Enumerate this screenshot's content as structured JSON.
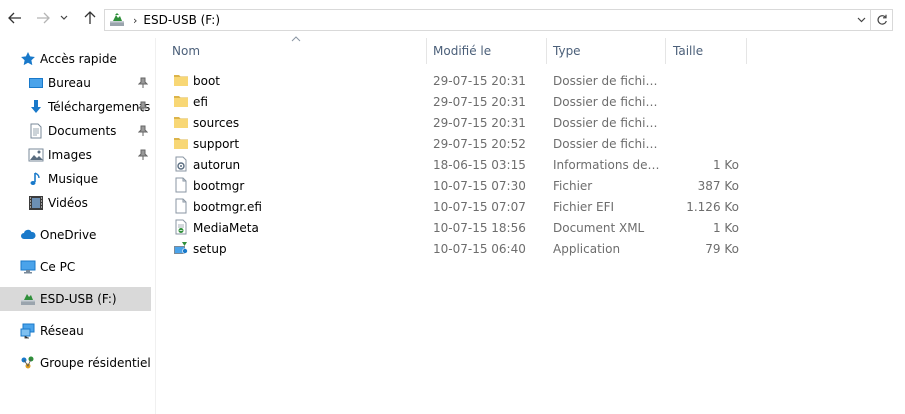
{
  "address": {
    "location_label": "ESD-USB (F:)"
  },
  "sidebar": {
    "items": [
      {
        "label": "Accès rapide",
        "icon": "star-icon"
      },
      {
        "label": "Bureau",
        "icon": "desktop-icon",
        "pinned": true
      },
      {
        "label": "Téléchargements",
        "icon": "download-icon",
        "pinned": true
      },
      {
        "label": "Documents",
        "icon": "documents-icon",
        "pinned": true
      },
      {
        "label": "Images",
        "icon": "images-icon",
        "pinned": true
      },
      {
        "label": "Musique",
        "icon": "music-icon"
      },
      {
        "label": "Vidéos",
        "icon": "videos-icon"
      },
      {
        "label": "OneDrive",
        "icon": "cloud-icon"
      },
      {
        "label": "Ce PC",
        "icon": "computer-icon"
      },
      {
        "label": "ESD-USB (F:)",
        "icon": "usb-drive-icon",
        "selected": true
      },
      {
        "label": "Réseau",
        "icon": "network-icon"
      },
      {
        "label": "Groupe résidentiel",
        "icon": "homegroup-icon"
      }
    ]
  },
  "columns": {
    "name": "Nom",
    "modified": "Modifié le",
    "type": "Type",
    "size": "Taille"
  },
  "files": [
    {
      "name": "boot",
      "modified": "29-07-15 20:31",
      "type": "Dossier de fichiers",
      "size": "",
      "icon": "folder-icon"
    },
    {
      "name": "efi",
      "modified": "29-07-15 20:31",
      "type": "Dossier de fichiers",
      "size": "",
      "icon": "folder-icon"
    },
    {
      "name": "sources",
      "modified": "29-07-15 20:31",
      "type": "Dossier de fichiers",
      "size": "",
      "icon": "folder-icon"
    },
    {
      "name": "support",
      "modified": "29-07-15 20:52",
      "type": "Dossier de fichiers",
      "size": "",
      "icon": "folder-icon"
    },
    {
      "name": "autorun",
      "modified": "18-06-15 03:15",
      "type": "Informations de c...",
      "size": "1 Ko",
      "icon": "settings-file-icon"
    },
    {
      "name": "bootmgr",
      "modified": "10-07-15 07:30",
      "type": "Fichier",
      "size": "387 Ko",
      "icon": "file-icon"
    },
    {
      "name": "bootmgr.efi",
      "modified": "10-07-15 07:07",
      "type": "Fichier EFI",
      "size": "1.126 Ko",
      "icon": "file-icon"
    },
    {
      "name": "MediaMeta",
      "modified": "10-07-15 18:56",
      "type": "Document XML",
      "size": "1 Ko",
      "icon": "xml-file-icon"
    },
    {
      "name": "setup",
      "modified": "10-07-15 06:40",
      "type": "Application",
      "size": "79 Ko",
      "icon": "setup-app-icon"
    }
  ],
  "colors": {
    "selected_bg": "#d9d9d9",
    "header_text": "#4c607a",
    "folder_yellow": "#f8d775",
    "accent_blue": "#1979ca"
  }
}
